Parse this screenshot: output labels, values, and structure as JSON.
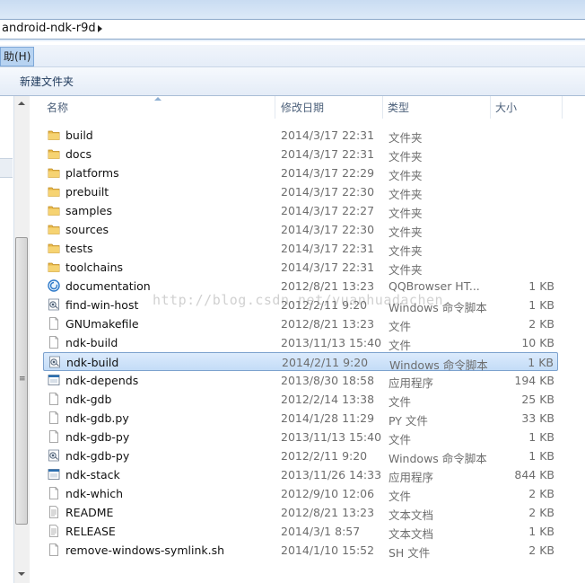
{
  "address_bar": {
    "path": "android-ndk-r9d"
  },
  "menu": {
    "help_label": "助(H)"
  },
  "toolbar": {
    "new_folder_label": "新建文件夹"
  },
  "columns": {
    "name": "名称",
    "date": "修改日期",
    "type": "类型",
    "size": "大小"
  },
  "watermark": "http://blog.csdn.net/yuanhuadachen",
  "files": [
    {
      "name": "build",
      "date": "2014/3/17 22:31",
      "type": "文件夹",
      "size": "",
      "icon": "folder-icon"
    },
    {
      "name": "docs",
      "date": "2014/3/17 22:31",
      "type": "文件夹",
      "size": "",
      "icon": "folder-icon"
    },
    {
      "name": "platforms",
      "date": "2014/3/17 22:29",
      "type": "文件夹",
      "size": "",
      "icon": "folder-icon"
    },
    {
      "name": "prebuilt",
      "date": "2014/3/17 22:30",
      "type": "文件夹",
      "size": "",
      "icon": "folder-icon"
    },
    {
      "name": "samples",
      "date": "2014/3/17 22:27",
      "type": "文件夹",
      "size": "",
      "icon": "folder-icon"
    },
    {
      "name": "sources",
      "date": "2014/3/17 22:30",
      "type": "文件夹",
      "size": "",
      "icon": "folder-icon"
    },
    {
      "name": "tests",
      "date": "2014/3/17 22:31",
      "type": "文件夹",
      "size": "",
      "icon": "folder-icon"
    },
    {
      "name": "toolchains",
      "date": "2014/3/17 22:31",
      "type": "文件夹",
      "size": "",
      "icon": "folder-icon"
    },
    {
      "name": "documentation",
      "date": "2012/8/21 13:23",
      "type": "QQBrowser HT...",
      "size": "1 KB",
      "icon": "browser-html-icon"
    },
    {
      "name": "find-win-host",
      "date": "2012/2/11 9:20",
      "type": "Windows 命令脚本",
      "size": "1 KB",
      "icon": "script-icon"
    },
    {
      "name": "GNUmakefile",
      "date": "2012/8/21 13:23",
      "type": "文件",
      "size": "2 KB",
      "icon": "file-icon"
    },
    {
      "name": "ndk-build",
      "date": "2013/11/13 15:40",
      "type": "文件",
      "size": "10 KB",
      "icon": "file-icon"
    },
    {
      "name": "ndk-build",
      "date": "2014/2/11 9:20",
      "type": "Windows 命令脚本",
      "size": "1 KB",
      "icon": "script-icon",
      "selected": true
    },
    {
      "name": "ndk-depends",
      "date": "2013/8/30 18:58",
      "type": "应用程序",
      "size": "194 KB",
      "icon": "application-icon"
    },
    {
      "name": "ndk-gdb",
      "date": "2012/2/14 13:38",
      "type": "文件",
      "size": "25 KB",
      "icon": "file-icon"
    },
    {
      "name": "ndk-gdb.py",
      "date": "2014/1/28 11:29",
      "type": "PY 文件",
      "size": "33 KB",
      "icon": "file-icon"
    },
    {
      "name": "ndk-gdb-py",
      "date": "2013/11/13 15:40",
      "type": "文件",
      "size": "1 KB",
      "icon": "file-icon"
    },
    {
      "name": "ndk-gdb-py",
      "date": "2012/2/11 9:20",
      "type": "Windows 命令脚本",
      "size": "1 KB",
      "icon": "script-icon"
    },
    {
      "name": "ndk-stack",
      "date": "2013/11/26 14:33",
      "type": "应用程序",
      "size": "844 KB",
      "icon": "application-icon"
    },
    {
      "name": "ndk-which",
      "date": "2012/9/10 12:06",
      "type": "文件",
      "size": "2 KB",
      "icon": "file-icon"
    },
    {
      "name": "README",
      "date": "2012/8/21 13:23",
      "type": "文本文档",
      "size": "2 KB",
      "icon": "text-document-icon"
    },
    {
      "name": "RELEASE",
      "date": "2014/3/1 8:57",
      "type": "文本文档",
      "size": "1 KB",
      "icon": "text-document-icon"
    },
    {
      "name": "remove-windows-symlink.sh",
      "date": "2014/1/10 15:52",
      "type": "SH 文件",
      "size": "2 KB",
      "icon": "file-icon"
    }
  ]
}
